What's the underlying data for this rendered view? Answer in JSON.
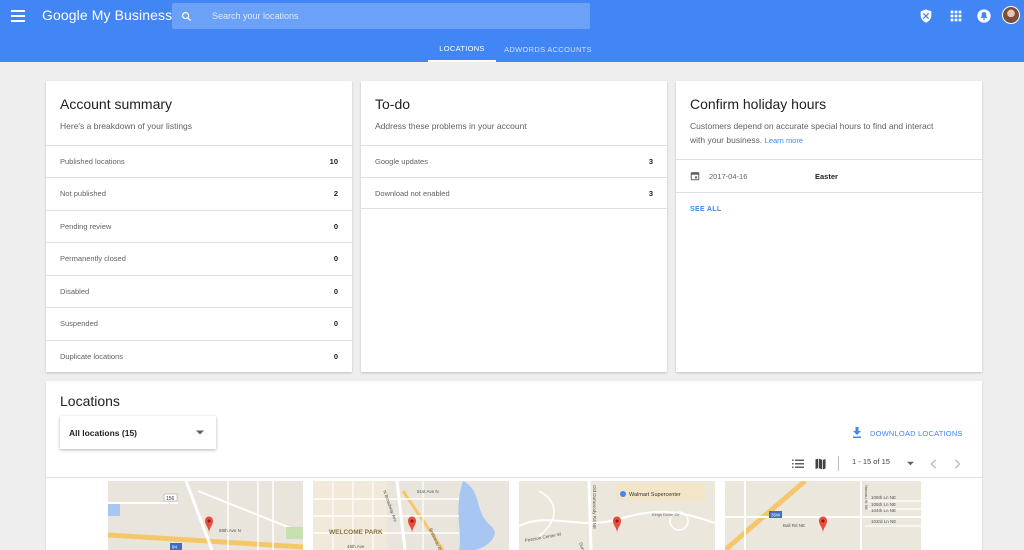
{
  "header": {
    "brand": "Google My Business",
    "search_placeholder": "Search your locations",
    "icons": [
      "menu-icon",
      "search-icon",
      "shield-icon",
      "apps-grid-icon",
      "notifications-icon",
      "avatar"
    ],
    "colors": {
      "bar": "#4285f4",
      "accent": "#4285f4"
    },
    "tabs": [
      {
        "label": "LOCATIONS",
        "active": true
      },
      {
        "label": "ADWORDS ACCOUNTS",
        "active": false
      }
    ]
  },
  "account_summary": {
    "title": "Account summary",
    "subtitle": "Here's a breakdown of your listings",
    "rows": [
      {
        "label": "Published locations",
        "value": "10"
      },
      {
        "label": "Not published",
        "value": "2"
      },
      {
        "label": "Pending review",
        "value": "0"
      },
      {
        "label": "Permanently closed",
        "value": "0"
      },
      {
        "label": "Disabled",
        "value": "0"
      },
      {
        "label": "Suspended",
        "value": "0"
      },
      {
        "label": "Duplicate locations",
        "value": "0"
      }
    ]
  },
  "todo": {
    "title": "To-do",
    "subtitle": "Address these problems in your account",
    "rows": [
      {
        "label": "Google updates",
        "value": "3"
      },
      {
        "label": "Download not enabled",
        "value": "3"
      }
    ]
  },
  "holiday": {
    "title": "Confirm holiday hours",
    "text_line1": "Customers depend on accurate special hours to find and interact",
    "text_line2": "with your business.",
    "learn_more": "Learn more",
    "date": "2017-04-16",
    "holiday_name": "Easter",
    "see_all": "SEE ALL"
  },
  "locations": {
    "title": "Locations",
    "filter_selected": "All locations (15)",
    "download_label": "DOWNLOAD LOCATIONS",
    "page_range": "1 - 15 of 15",
    "maps": [
      {
        "labels": [
          "156",
          "58th Ave N",
          "94"
        ]
      },
      {
        "labels": [
          "N Broadway Ave",
          "51st Ave N",
          "WELCOME PARK",
          "Bottineau Blvd",
          "49th Ave"
        ]
      },
      {
        "labels": [
          "Walmart Supercenter",
          "Kings Down Cir",
          "Pearson Center W",
          "Old Dunwoody Rd NE",
          "Dunwoody Rd NE"
        ]
      },
      {
        "labels": [
          "106th Ln NE",
          "105th Ln NE",
          "104th Ln NE",
          "103rd Ln NE",
          "Ball Rd NE",
          "Nassau St NE",
          "35W"
        ]
      }
    ]
  }
}
